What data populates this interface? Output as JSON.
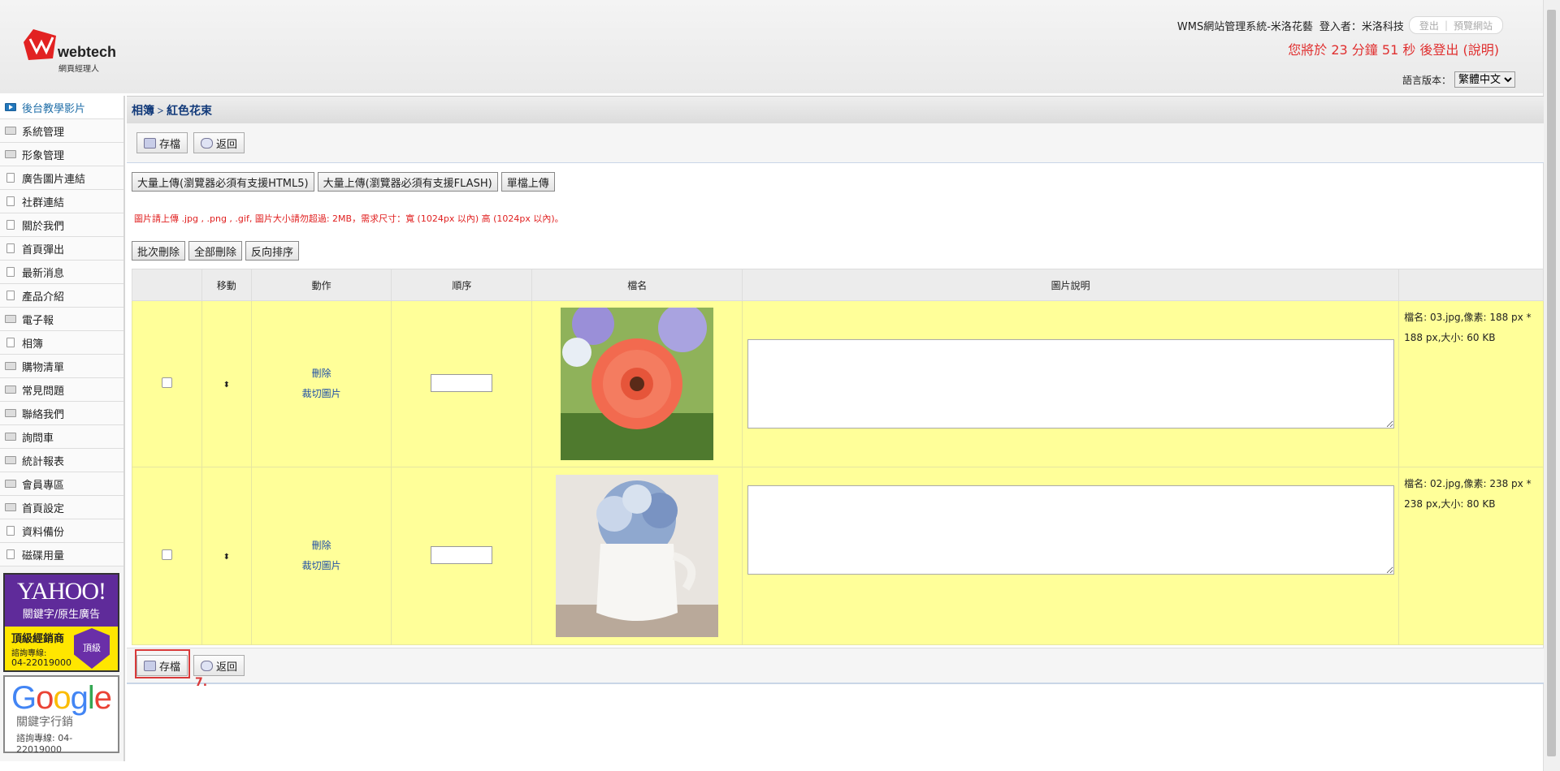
{
  "header": {
    "logo_text": "webtech",
    "logo_sub": "網頁經理人",
    "system_title": "WMS網站管理系統-米洛花藝",
    "login_label": "登入者：米洛科技",
    "logout_button": "登出",
    "preview_button": "預覽網站",
    "logout_message": "您將於 23 分鐘 51 秒 後登出 (說明)",
    "language_label": "語言版本：",
    "language_value": "繁體中文"
  },
  "sidebar": {
    "items": [
      {
        "label": "後台教學影片",
        "icon": "play-icon"
      },
      {
        "label": "系統管理",
        "icon": "folder-icon"
      },
      {
        "label": "形象管理",
        "icon": "folder-icon"
      },
      {
        "label": "廣告圖片連結",
        "icon": "document-icon"
      },
      {
        "label": "社群連結",
        "icon": "document-icon"
      },
      {
        "label": "關於我們",
        "icon": "document-icon"
      },
      {
        "label": "首頁彈出",
        "icon": "document-icon"
      },
      {
        "label": "最新消息",
        "icon": "document-icon"
      },
      {
        "label": "產品介紹",
        "icon": "document-icon"
      },
      {
        "label": "電子報",
        "icon": "folder-icon"
      },
      {
        "label": "相簿",
        "icon": "document-icon"
      },
      {
        "label": "購物清單",
        "icon": "folder-icon"
      },
      {
        "label": "常見問題",
        "icon": "folder-icon"
      },
      {
        "label": "聯絡我們",
        "icon": "folder-icon"
      },
      {
        "label": "詢問車",
        "icon": "folder-icon"
      },
      {
        "label": "統計報表",
        "icon": "folder-icon"
      },
      {
        "label": "會員專區",
        "icon": "folder-icon"
      },
      {
        "label": "首頁設定",
        "icon": "folder-icon"
      },
      {
        "label": "資料備份",
        "icon": "document-icon"
      },
      {
        "label": "磁碟用量",
        "icon": "document-icon"
      }
    ],
    "ad_yahoo": {
      "brand": "YAHOO!",
      "line1": "關鍵字/原生廣告",
      "line2": "頂級經銷商",
      "line3": "諮詢專線:",
      "phone": "04-22019000",
      "badge": "頂級"
    },
    "ad_google": {
      "brand": "Google",
      "line1": "關鍵字行銷",
      "line2": "諮詢專線: 04-22019000"
    }
  },
  "breadcrumb": "相簿 > 紅色花束",
  "toolbar": {
    "save": "存檔",
    "back": "返回"
  },
  "upload": {
    "html5": "大量上傳(瀏覽器必須有支援HTML5)",
    "flash": "大量上傳(瀏覽器必須有支援FLASH)",
    "single": "單檔上傳"
  },
  "note": "圖片請上傳 .jpg , .png , .gif, 圖片大小請勿超過: 2MB，需求尺寸：寬 (1024px 以內) 高 (1024px 以內)。",
  "bulk": {
    "batch_delete": "批次刪除",
    "delete_all": "全部刪除",
    "reverse": "反向排序"
  },
  "table": {
    "headers": [
      "",
      "移動",
      "動作",
      "順序",
      "檔名",
      "圖片說明",
      ""
    ],
    "rows": [
      {
        "delete": "刪除",
        "crop": "裁切圖片",
        "order": "",
        "description": "",
        "info": "檔名: 03.jpg,像素: 188 px * 188 px,大小: 60 KB"
      },
      {
        "delete": "刪除",
        "crop": "裁切圖片",
        "order": "",
        "description": "",
        "info": "檔名: 02.jpg,像素: 238 px * 238 px,大小: 80 KB"
      }
    ]
  },
  "annotation": {
    "step": "7."
  },
  "colors": {
    "accent": "#123a7a",
    "warning": "#e02020",
    "row_bg": "#ffff99",
    "highlight": "#d93a3a"
  }
}
